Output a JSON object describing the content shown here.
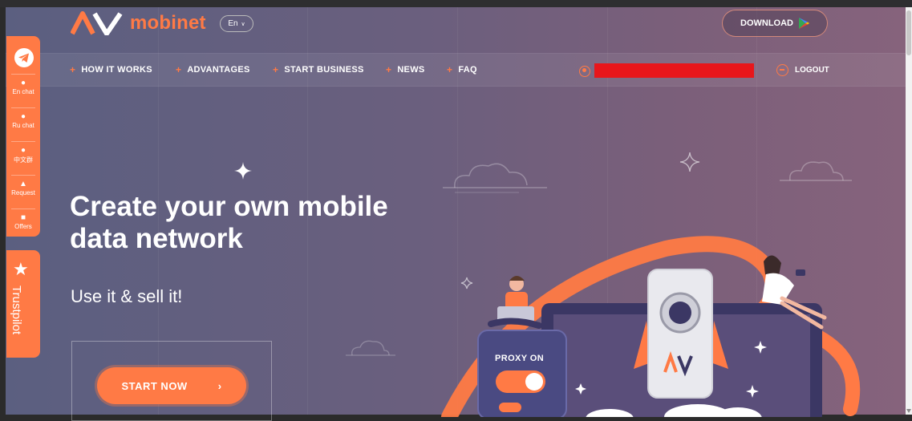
{
  "brand": {
    "name": "mobinet",
    "accent_color": "#ff7a45",
    "logo_icon": "mobinet-logo-icon"
  },
  "language": {
    "selected": "En"
  },
  "header": {
    "download_label": "DOWNLOAD",
    "download_icon": "google-play-icon"
  },
  "nav": {
    "items": [
      {
        "label": "HOW IT WORKS"
      },
      {
        "label": "ADVANTAGES"
      },
      {
        "label": "START BUSINESS"
      },
      {
        "label": "NEWS"
      },
      {
        "label": "FAQ"
      }
    ],
    "logout_label": "LOGOUT"
  },
  "sidebar": {
    "items": [
      {
        "label": "En chat",
        "icon": "chat-icon"
      },
      {
        "label": "Ru chat",
        "icon": "chat-icon"
      },
      {
        "label": "中文群",
        "icon": "chat-icon"
      },
      {
        "label": "Request",
        "icon": "megaphone-icon"
      },
      {
        "label": "Offers",
        "icon": "money-bag-icon"
      }
    ],
    "trustpilot_label": "Trustpilot"
  },
  "hero": {
    "title_line1": "Create your own mobile",
    "title_line2": "data network",
    "subtitle": "Use it & sell it!",
    "cta_label": "START NOW",
    "cta_icon": "chevron-right-icon"
  },
  "illustration": {
    "proxy_label": "PROXY ON",
    "phone_logo": "AV"
  }
}
